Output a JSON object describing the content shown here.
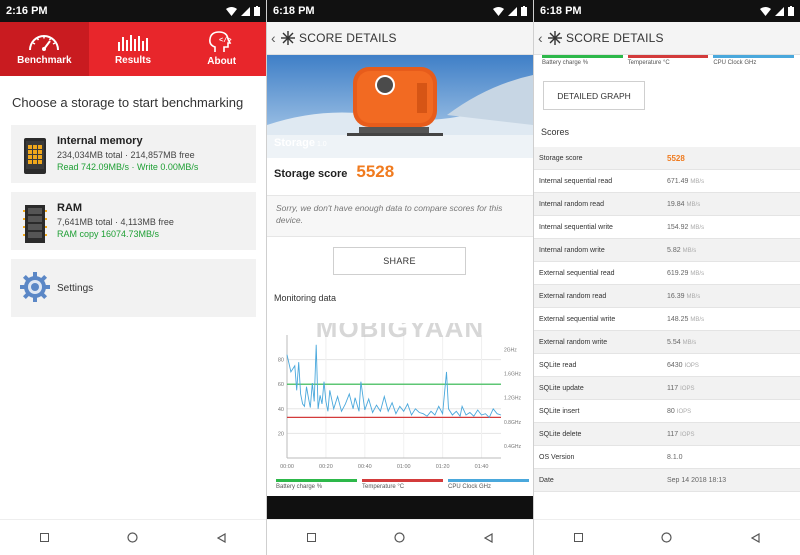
{
  "colors": {
    "brand_red": "#e8262b",
    "score_orange": "#f07b1f",
    "green_text": "#1e9f34",
    "battery": "#2db84a",
    "temperature": "#d33b3b",
    "cpu_clock": "#4aa8dc"
  },
  "panel1": {
    "status_time": "2:16 PM",
    "tabs": [
      {
        "label": "Benchmark",
        "icon": "speedometer-icon",
        "active": true
      },
      {
        "label": "Results",
        "icon": "bar-chart-icon",
        "active": false
      },
      {
        "label": "About",
        "icon": "head-code-icon",
        "active": false
      }
    ],
    "heading": "Choose a storage to start benchmarking",
    "cards": [
      {
        "title": "Internal memory",
        "sub": "234,034MB total · 214,857MB free",
        "perf": "Read 742.09MB/s · Write 0.00MB/s",
        "icon": "phone-storage-icon"
      },
      {
        "title": "RAM",
        "sub": "7,641MB total · 4,113MB free",
        "perf": "RAM copy 16074.73MB/s",
        "icon": "ram-chip-icon"
      }
    ],
    "settings_label": "Settings"
  },
  "panel2": {
    "status_time": "6:18 PM",
    "header_title": "SCORE DETAILS",
    "hero_label": "Storage",
    "hero_version": "1.0",
    "score_label": "Storage score",
    "score_value": "5528",
    "sorry_text": "Sorry, we don't have enough data to compare scores for this device.",
    "share_label": "SHARE",
    "monitoring_title": "Monitoring data",
    "watermark": "MOBIGYAAN",
    "legend": [
      "Battery charge %",
      "Temperature °C",
      "CPU Clock GHz"
    ],
    "chart_data": {
      "type": "line",
      "x_ticks": [
        "00:00",
        "00:20",
        "00:40",
        "01:00",
        "01:20",
        "01:40"
      ],
      "y_ticks_left": [
        "20",
        "40",
        "60",
        "80"
      ],
      "y_ticks_right": [
        "0.4GHz",
        "0.8GHz",
        "1.2GHz",
        "1.6GHz",
        "2GHz"
      ],
      "ylim": [
        0,
        100
      ],
      "series": [
        {
          "name": "Battery charge %",
          "color": "#2db84a",
          "values": [
            [
              0,
              60
            ],
            [
              110,
              60
            ]
          ]
        },
        {
          "name": "Temperature °C",
          "color": "#d33b3b",
          "values": [
            [
              0,
              33
            ],
            [
              110,
              33
            ]
          ]
        },
        {
          "name": "CPU Clock GHz",
          "color": "#4aa8dc",
          "values": [
            [
              0,
              84
            ],
            [
              2,
              70
            ],
            [
              4,
              75
            ],
            [
              5,
              55
            ],
            [
              6,
              78
            ],
            [
              7,
              52
            ],
            [
              8,
              44
            ],
            [
              9,
              42
            ],
            [
              10,
              58
            ],
            [
              11,
              49
            ],
            [
              12,
              41
            ],
            [
              13,
              61
            ],
            [
              14,
              46
            ],
            [
              15,
              92
            ],
            [
              16,
              40
            ],
            [
              17,
              51
            ],
            [
              18,
              44
            ],
            [
              19,
              62
            ],
            [
              20,
              46
            ],
            [
              21,
              38
            ],
            [
              22,
              55
            ],
            [
              24,
              40
            ],
            [
              26,
              50
            ],
            [
              28,
              38
            ],
            [
              30,
              44
            ],
            [
              32,
              52
            ],
            [
              34,
              40
            ],
            [
              35,
              49
            ],
            [
              37,
              38
            ],
            [
              38,
              62
            ],
            [
              40,
              39
            ],
            [
              42,
              48
            ],
            [
              44,
              37
            ],
            [
              46,
              43
            ],
            [
              48,
              38
            ],
            [
              50,
              50
            ],
            [
              52,
              38
            ],
            [
              54,
              45
            ],
            [
              56,
              36
            ],
            [
              58,
              42
            ],
            [
              60,
              38
            ],
            [
              62,
              44
            ],
            [
              64,
              35
            ],
            [
              66,
              40
            ],
            [
              68,
              37
            ],
            [
              70,
              36
            ],
            [
              72,
              34
            ],
            [
              74,
              38
            ],
            [
              76,
              35
            ],
            [
              78,
              42
            ],
            [
              80,
              36
            ],
            [
              82,
              70
            ],
            [
              83,
              40
            ],
            [
              85,
              35
            ],
            [
              87,
              38
            ],
            [
              89,
              34
            ],
            [
              90,
              42
            ],
            [
              92,
              35
            ],
            [
              94,
              37
            ],
            [
              96,
              34
            ],
            [
              98,
              39
            ],
            [
              100,
              35
            ],
            [
              102,
              36
            ],
            [
              104,
              33
            ],
            [
              106,
              40
            ],
            [
              108,
              36
            ],
            [
              110,
              35
            ]
          ]
        }
      ]
    }
  },
  "panel3": {
    "status_time": "6:18 PM",
    "header_title": "SCORE DETAILS",
    "legend": [
      "Battery charge %",
      "Temperature °C",
      "CPU Clock GHz"
    ],
    "detailed_graph_label": "DETAILED GRAPH",
    "scores_title": "Scores",
    "rows": [
      {
        "k": "Storage score",
        "v": "5528",
        "u": "",
        "highlight": true
      },
      {
        "k": "Internal sequential read",
        "v": "671.49",
        "u": "MB/s"
      },
      {
        "k": "Internal random read",
        "v": "19.84",
        "u": "MB/s"
      },
      {
        "k": "Internal sequential write",
        "v": "154.92",
        "u": "MB/s"
      },
      {
        "k": "Internal random write",
        "v": "5.82",
        "u": "MB/s"
      },
      {
        "k": "External sequential read",
        "v": "619.29",
        "u": "MB/s"
      },
      {
        "k": "External random read",
        "v": "16.39",
        "u": "MB/s"
      },
      {
        "k": "External sequential write",
        "v": "148.25",
        "u": "MB/s"
      },
      {
        "k": "External random write",
        "v": "5.54",
        "u": "MB/s"
      },
      {
        "k": "SQLite read",
        "v": "6430",
        "u": "IOPS"
      },
      {
        "k": "SQLite update",
        "v": "117",
        "u": "IOPS"
      },
      {
        "k": "SQLite insert",
        "v": "80",
        "u": "IOPS"
      },
      {
        "k": "SQLite delete",
        "v": "117",
        "u": "IOPS"
      },
      {
        "k": "OS Version",
        "v": "8.1.0",
        "u": ""
      },
      {
        "k": "Date",
        "v": "Sep 14 2018 18:13",
        "u": ""
      }
    ]
  }
}
